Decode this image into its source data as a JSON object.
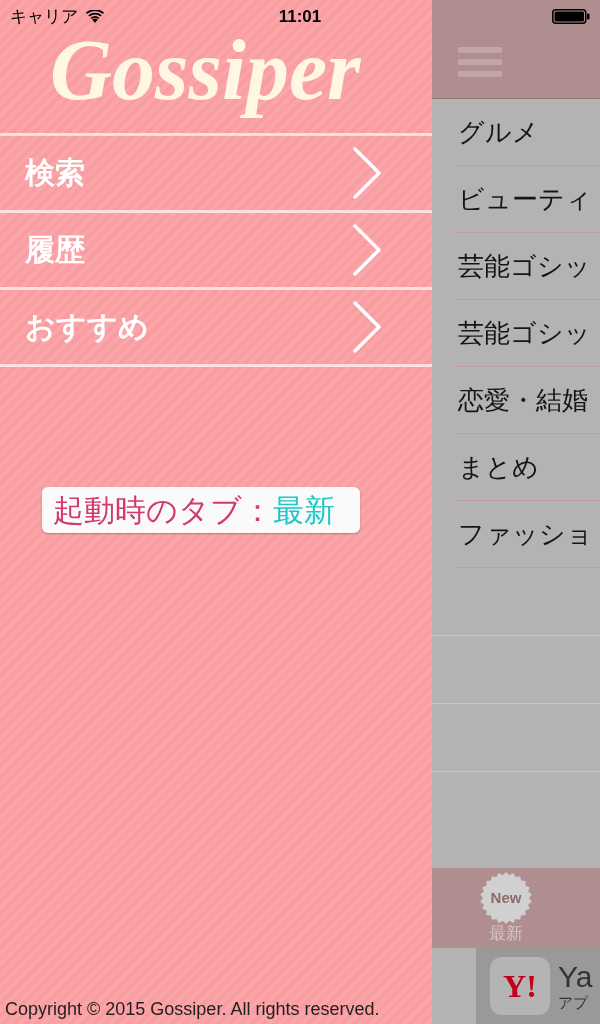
{
  "status_bar": {
    "carrier": "キャリア",
    "time": "11:01"
  },
  "drawer": {
    "logo": "Gossiper",
    "menu": [
      {
        "label": "検索"
      },
      {
        "label": "履歴"
      },
      {
        "label": "おすすめ"
      }
    ],
    "startup_tab": {
      "label": "起動時のタブ：",
      "value": "最新"
    },
    "copyright": "Copyright © 2015 Gossiper. All rights reserved."
  },
  "main": {
    "categories": [
      {
        "label": "グルメ"
      },
      {
        "label": "ビューティ"
      },
      {
        "label": "芸能ゴシッ"
      },
      {
        "label": "芸能ゴシッ"
      },
      {
        "label": "恋愛・結婚"
      },
      {
        "label": "まとめ"
      },
      {
        "label": "ファッショ"
      }
    ],
    "tab_bar": {
      "tabs": [
        {
          "badge": "New",
          "label": "最新"
        }
      ]
    },
    "ad": {
      "icon_text": "Y!",
      "title": "Ya",
      "subtitle": "アプ"
    }
  }
}
